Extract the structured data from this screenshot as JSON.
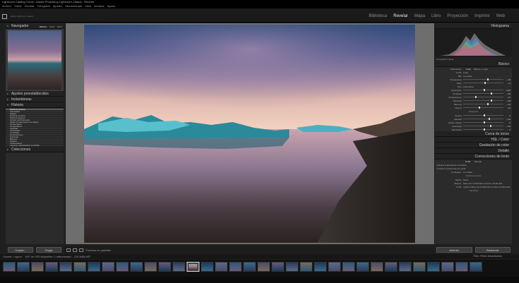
{
  "window": {
    "title": "Lightroom Catalog 3.lrcat - Adobe Photoshop Lightroom Classic - Revelar"
  },
  "menu": [
    "Archivo",
    "Editar",
    "Revelar",
    "Fotografía",
    "Ajustes",
    "Herramientas",
    "Vista",
    "Ventana",
    "Ayuda"
  ],
  "identity": {
    "catalog": "Adobe Lightroom Classic"
  },
  "modules": [
    {
      "label": "Biblioteca",
      "active": false
    },
    {
      "label": "Revelar",
      "active": true
    },
    {
      "label": "Mapa",
      "active": false
    },
    {
      "label": "Libro",
      "active": false
    },
    {
      "label": "Proyección",
      "active": false
    },
    {
      "label": "Imprimir",
      "active": false
    },
    {
      "label": "Web",
      "active": false
    }
  ],
  "left": {
    "navigator": {
      "title": "Navegador",
      "zoom": [
        "ENCAJ.",
        "100%",
        "100%"
      ]
    },
    "presets": "Ajustes preestablecidos",
    "snapshots": "Instantáneas",
    "history": {
      "title": "Historia",
      "items": [
        "Perfil de la lente",
        "Intensidad",
        "Nitidez",
        "Perfil de la lente",
        "Perfil de la lente",
        "Activar perfil de lente",
        "Quitar la aberración cromática",
        "Temperatura",
        "Temperatura",
        "Claridad",
        "Intensidad",
        "Contraste",
        "Iluminaciones",
        "Sombras",
        "Blancos",
        "Negros",
        "Temperatura",
        "Importar (20/04/2023 12:38:56)"
      ]
    },
    "collections": "Colecciones",
    "copy": "Copiar...",
    "paste": "Pegar"
  },
  "toolbar": {
    "proof": "Pruebas en pantalla"
  },
  "right": {
    "histogram": "Histograma",
    "histinfo": "Fotografía original",
    "basic": "Básico",
    "treatment": "Tratamiento:",
    "color": "Color",
    "bw": "Blanco y negro",
    "profile": "Perfil:",
    "profile_val": "Color",
    "wb": "BB:",
    "wb_val": "A medida",
    "tone": "Tono",
    "auto": "Automático",
    "presence": "Presencia",
    "sliders_wb": [
      {
        "l": "Temperatura",
        "v": "+ 18",
        "p": 0.6
      },
      {
        "l": "Matiz",
        "v": "+ 4",
        "p": 0.52
      }
    ],
    "sliders_tone": [
      {
        "l": "Exposición",
        "v": "0,00",
        "p": 0.5
      },
      {
        "l": "Contraste",
        "v": "+ 36",
        "p": 0.68
      },
      {
        "l": "Iluminaciones",
        "v": "- 37",
        "p": 0.3
      },
      {
        "l": "Sombras",
        "v": "+ 38",
        "p": 0.68
      },
      {
        "l": "Blancos",
        "v": "+ 19",
        "p": 0.6
      },
      {
        "l": "Negros",
        "v": "- 22",
        "p": 0.38
      }
    ],
    "sliders_presence": [
      {
        "l": "Textura",
        "v": "0",
        "p": 0.5
      },
      {
        "l": "Claridad",
        "v": "+ 26",
        "p": 0.63
      },
      {
        "l": "Quitar neblina",
        "v": "0",
        "p": 0.5
      },
      {
        "l": "Intensidad",
        "v": "+ 32",
        "p": 0.66
      },
      {
        "l": "Saturación",
        "v": "0",
        "p": 0.5
      }
    ],
    "tonecurve": "Curva de tonos",
    "hsl": "HSL / Color",
    "colorgrading": "Gradación de color",
    "detail": "Detalle",
    "lens": "Correcciones de lente",
    "lens_tabs": [
      "Perfil",
      "Manual"
    ],
    "lens_opts": [
      "Quitar la aberración cromática",
      "Activar correcciones de perfil"
    ],
    "setup": "Configurar:",
    "setup_val": "A medida",
    "lensprofile": "Perfil de la lente",
    "make": "Marca:",
    "make_val": "Nikon",
    "model": "Modelo:",
    "model_val": "Nikon AF-S NIKKOR 14-24mm f/2.8G ED",
    "profile2": "Perfil:",
    "profile2_val": "Adobe (Nikon AF-S NIKKOR 14-24mm f/2.8G ED)",
    "amount": "Cantidad",
    "prev": "Anterior",
    "reset": "Restaurar"
  },
  "filmhead": {
    "source": "Carpeta : Laguna",
    "count": "1097 de 1520 fotografías / 1 seleccionada / _DSC4668.NEF",
    "filter": "Filtro:",
    "filter_val": "Filtros desactivados"
  },
  "filmstrip_count": 34,
  "colors": {
    "accent": "#e8e8e8",
    "panel": "#2b2b2b",
    "bg": "#1f1f1f"
  }
}
